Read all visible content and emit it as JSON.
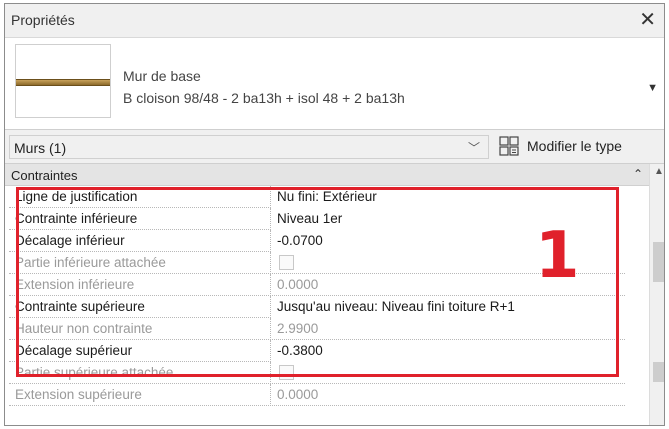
{
  "panel": {
    "title": "Propriétés",
    "close_icon": "close-icon"
  },
  "type_selector": {
    "family": "Mur de base",
    "type": "B cloison 98/48 - 2 ba13h + isol 48 + 2 ba13h",
    "swatch_color": "#b48a3e"
  },
  "instance_selector": {
    "value": "Murs (1)",
    "edit_type_label": "Modifier le type"
  },
  "group": {
    "label": "Contraintes"
  },
  "rows": [
    {
      "name": "Ligne de justification",
      "value": "Nu fini: Extérieur",
      "enabled": true
    },
    {
      "name": "Contrainte inférieure",
      "value": "Niveau 1er",
      "enabled": true
    },
    {
      "name": "Décalage inférieur",
      "value": "-0.0700",
      "enabled": true
    },
    {
      "name": "Partie inférieure attachée",
      "value": "",
      "checkbox": true,
      "enabled": false
    },
    {
      "name": "Extension inférieure",
      "value": "0.0000",
      "enabled": false
    },
    {
      "name": "Contrainte supérieure",
      "value": "Jusqu'au niveau: Niveau fini toiture R+1",
      "enabled": true
    },
    {
      "name": "Hauteur non contrainte",
      "value": "2.9900",
      "enabled": false
    },
    {
      "name": "Décalage supérieur",
      "value": "-0.3800",
      "enabled": true
    },
    {
      "name": "Partie supérieure attachée",
      "value": "",
      "checkbox": true,
      "enabled": false
    },
    {
      "name": "Extension supérieure",
      "value": "0.0000",
      "enabled": false
    }
  ],
  "annotation": {
    "number": "1",
    "color": "#e0212b"
  }
}
